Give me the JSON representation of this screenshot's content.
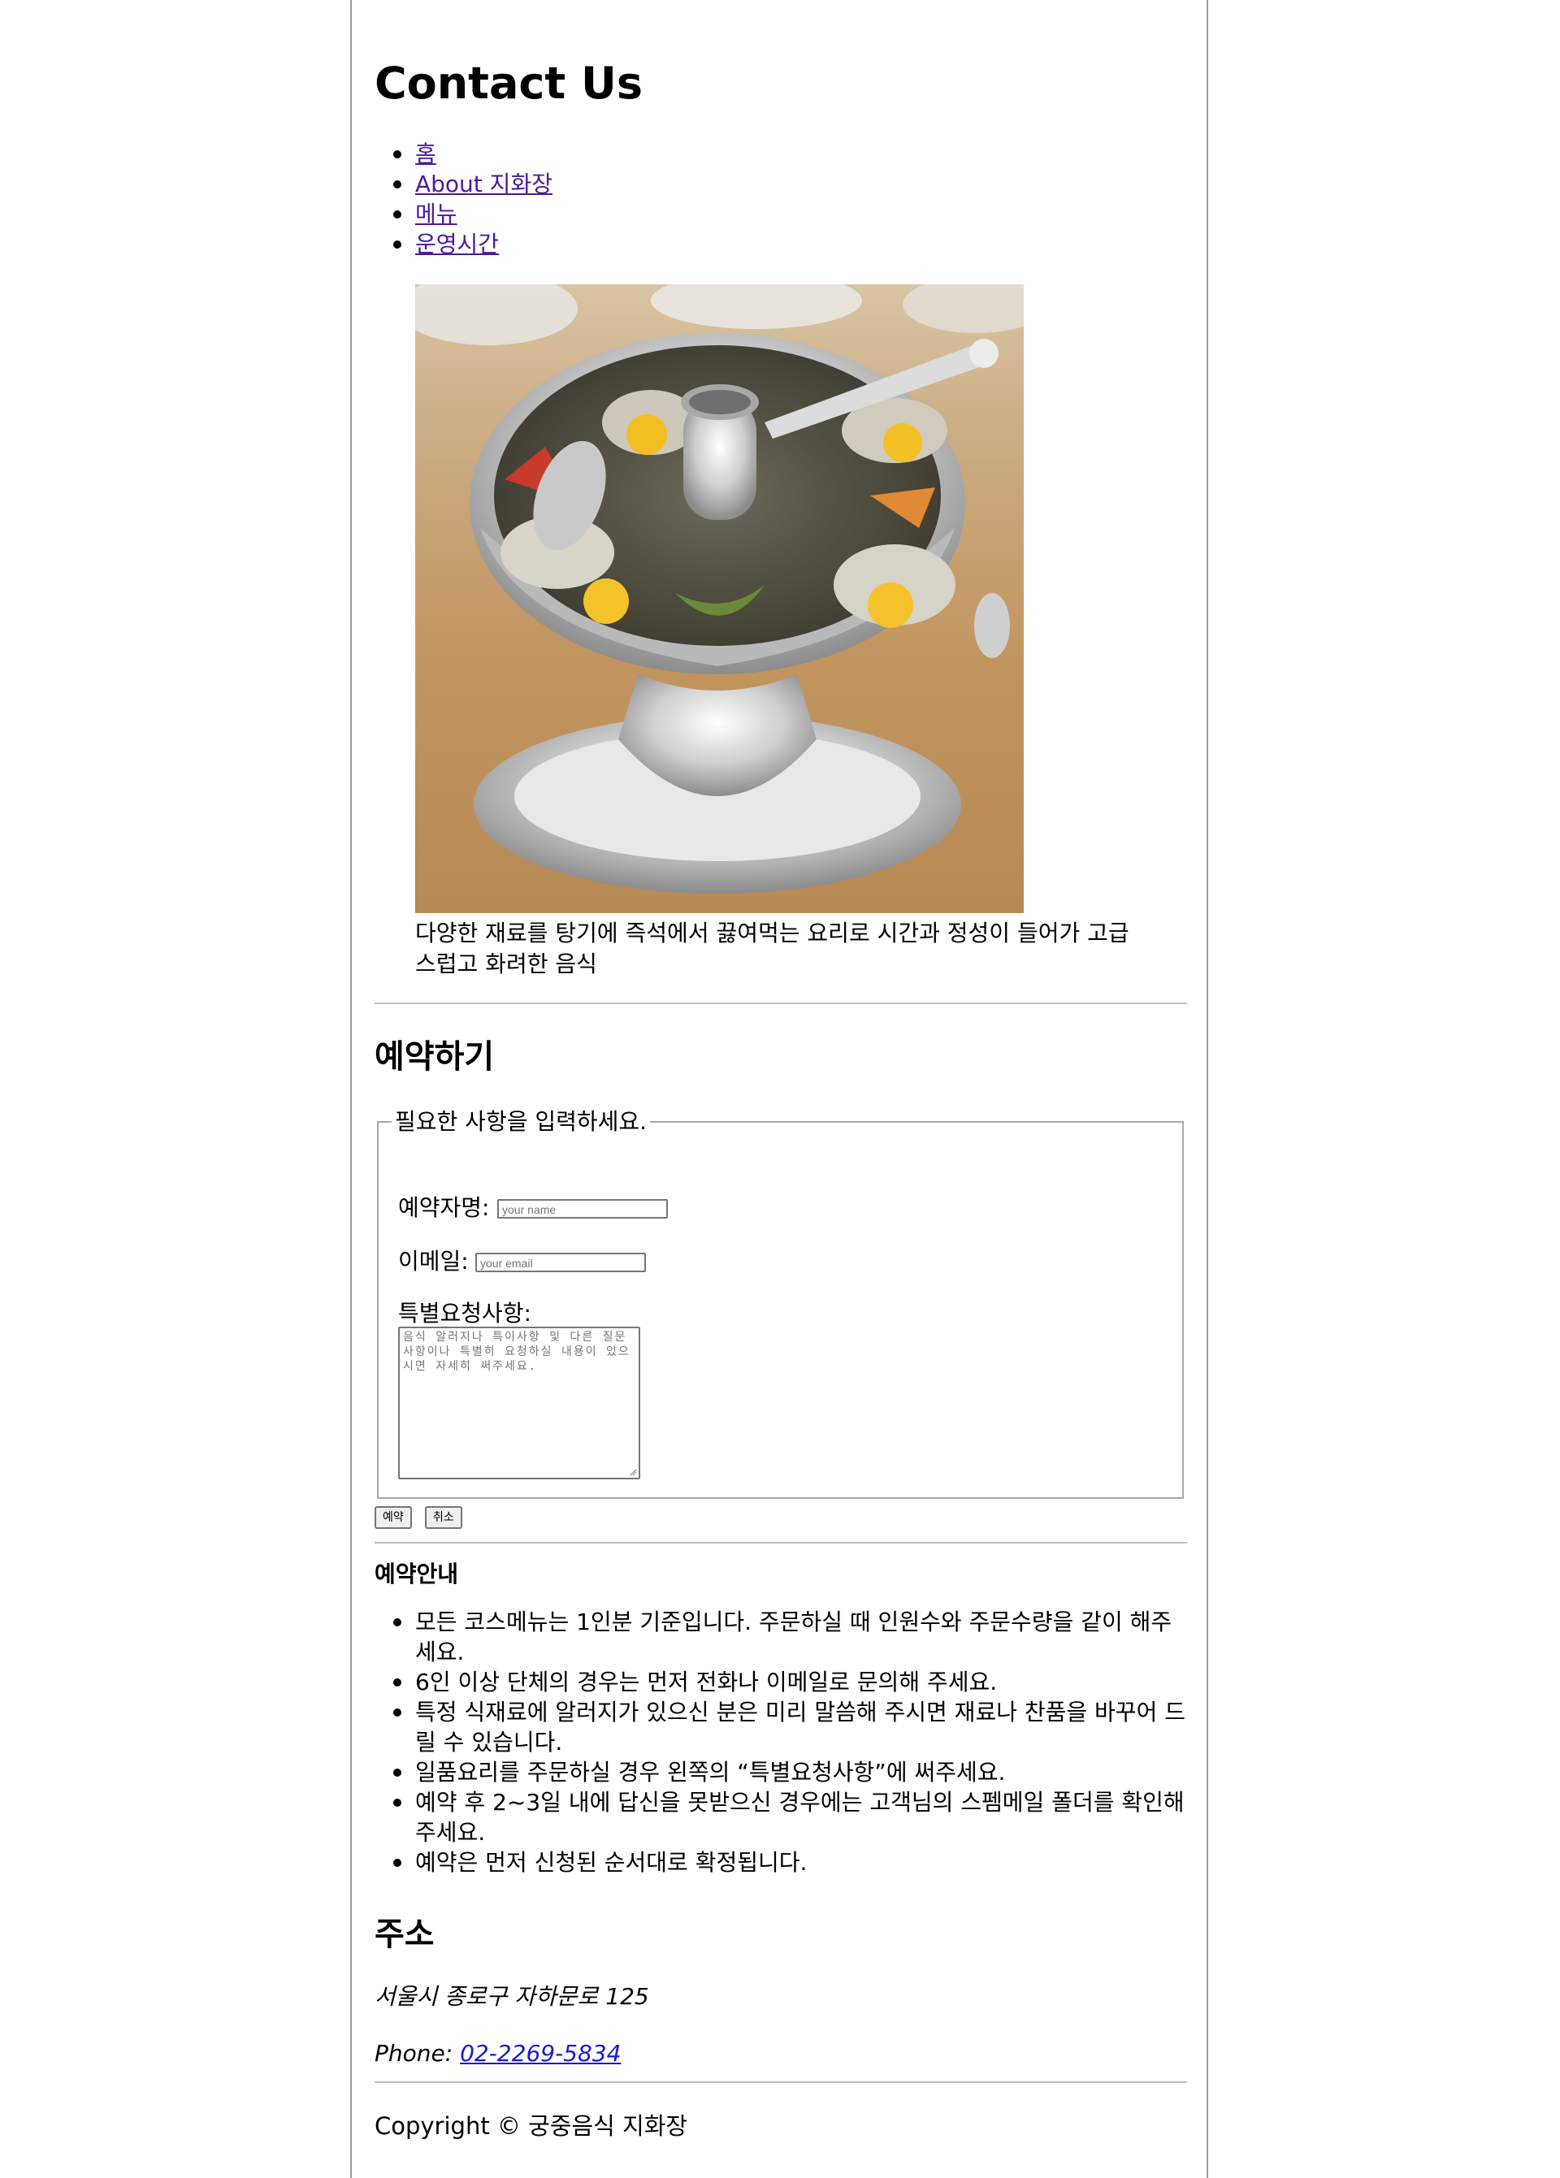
{
  "page": {
    "title": "Contact Us"
  },
  "nav": {
    "items": [
      "홈",
      "About 지화장",
      "메뉴",
      "운영시간"
    ]
  },
  "feature": {
    "image_alt": "신선로",
    "caption": "다양한 재료를 탕기에 즉석에서 끓여먹는 요리로 시간과 정성이 들어가 고급스럽고 화려한 음식"
  },
  "reservation": {
    "heading": "예약하기",
    "legend": "필요한 사항을 입력하세요.",
    "name_label": "예약자명:",
    "name_placeholder": "your name",
    "email_label": "이메일:",
    "email_placeholder": "your email",
    "request_label": "특별요청사항:",
    "request_placeholder": "음식 알러지나 특이사항 및 다른 질문사항이나 특별히 요청하실 내용이 있으시면 자세히 써주세요.",
    "submit_label": "예약",
    "cancel_label": "취소"
  },
  "guide": {
    "heading": "예약안내",
    "items": [
      "모든 코스메뉴는 1인분 기준입니다. 주문하실 때 인원수와 주문수량을 같이 해주세요.",
      "6인 이상 단체의 경우는 먼저 전화나 이메일로 문의해 주세요.",
      "특정 식재료에 알러지가 있으신 분은 미리 말씀해 주시면 재료나 찬품을 바꾸어 드릴 수 있습니다.",
      "일품요리를 주문하실 경우 왼쪽의 “특별요청사항”에 써주세요.",
      "예약 후 2~3일 내에 답신을 못받으신 경우에는 고객님의 스펨메일 폴더를 확인해 주세요.",
      "예약은 먼저 신청된 순서대로 확정됩니다."
    ]
  },
  "address": {
    "heading": "주소",
    "street": "서울시 종로구 자하문로 125",
    "phone_label": "Phone:",
    "phone": "02-2269-5834"
  },
  "footer": {
    "copyright": "Copyright © 궁중음식 지화장"
  },
  "colors": {
    "link": "#4b1a99",
    "phone_link": "#1a1ad6",
    "border": "#9a9a9a"
  }
}
